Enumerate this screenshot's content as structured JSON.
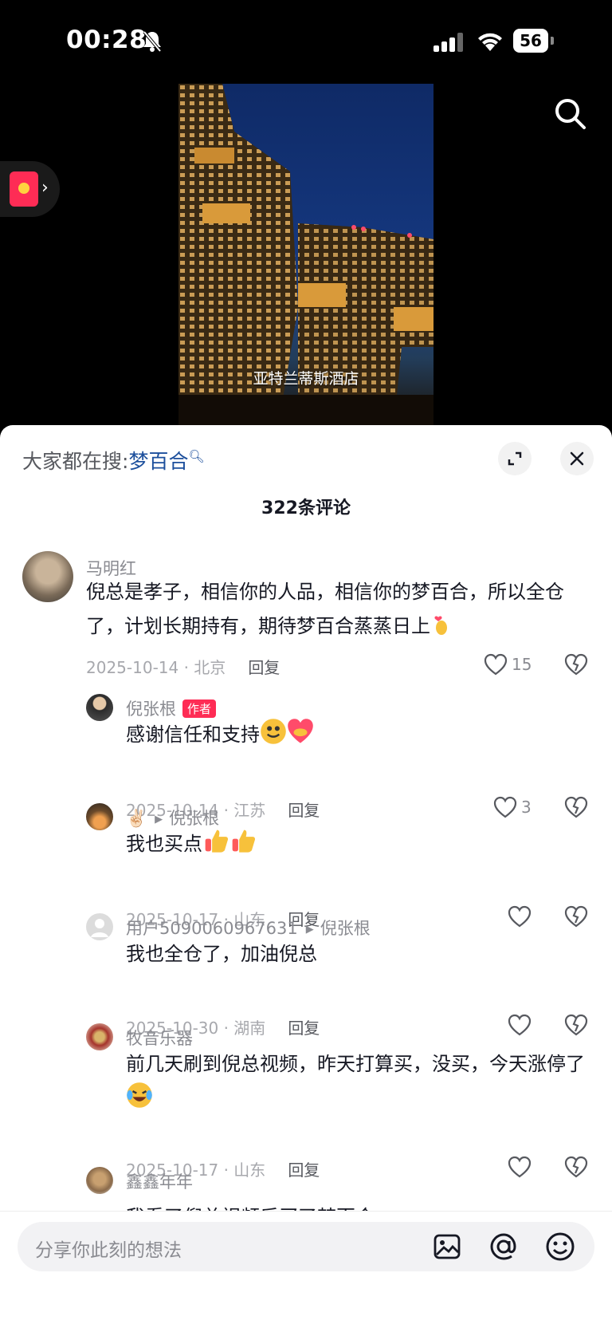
{
  "status_bar": {
    "time": "00:28",
    "battery": "56"
  },
  "video": {
    "caption": "亚特兰蒂斯酒店"
  },
  "sheet": {
    "search_prefix": "大家都在搜:",
    "search_keyword": "梦百合",
    "comment_count": "322条评论"
  },
  "comments": [
    {
      "name": "马明红",
      "text": "倪总是孝子，相信你的人品，相信你的梦百合，所以全仓了，计划长期持有，期待梦百合蒸蒸日上",
      "date_location": "2025-10-14 · 北京",
      "reply": "回复",
      "likes": "15"
    },
    {
      "name": "倪张根",
      "badge": "作者",
      "text": "感谢信任和支持",
      "date_location": "2025-10-14 · 江苏",
      "reply": "回复",
      "likes": "3"
    },
    {
      "name": "✌🏻",
      "reply_to": "倪张根",
      "text": "我也买点",
      "date_location": "2025-10-17 · 山东",
      "reply": "回复"
    },
    {
      "name": "用户5090060967631",
      "reply_to": "倪张根",
      "text": "我也全仓了，加油倪总",
      "date_location": "2025-10-30 · 湖南",
      "reply": "回复"
    },
    {
      "name": "牧音乐器",
      "text": "前几天刷到倪总视频，昨天打算买，没买，今天涨停了",
      "date_location": "2025-10-17 · 山东",
      "reply": "回复"
    },
    {
      "name": "鑫鑫年年",
      "text": "我看了倪总视频后买了梦百合"
    }
  ],
  "input": {
    "placeholder": "分享你此刻的想法"
  },
  "icons": [
    "bell-slash-icon",
    "signal-icon",
    "wifi-icon",
    "search-icon",
    "red-packet-icon",
    "expand-icon",
    "close-icon",
    "heart-icon",
    "broken-heart-icon",
    "image-icon",
    "at-icon",
    "emoji-icon"
  ],
  "colors": {
    "accent": "#fe2c55",
    "link": "#1c4f9c"
  }
}
